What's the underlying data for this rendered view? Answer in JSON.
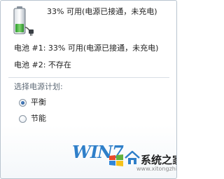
{
  "battery": {
    "icon": "battery-charging-plug-icon",
    "summary": "33% 可用(电源已接通，未充电)",
    "batteries": [
      {
        "label": "电池 #1:",
        "status": "33% 可用(电源已接通，未充电)"
      },
      {
        "label": "电池 #2:",
        "status": "不存在"
      }
    ]
  },
  "power_plan": {
    "heading": "选择电源计划:",
    "options": [
      {
        "label": "平衡",
        "selected": true
      },
      {
        "label": "节能",
        "selected": false
      }
    ]
  },
  "watermark": {
    "logo_text": "WIN7",
    "brand": "系统之家",
    "site": "www.xitongzhijia.net"
  },
  "colors": {
    "accent": "#2f7fc9",
    "battery_green": "#3cae3a",
    "border": "#b9c4cf"
  }
}
